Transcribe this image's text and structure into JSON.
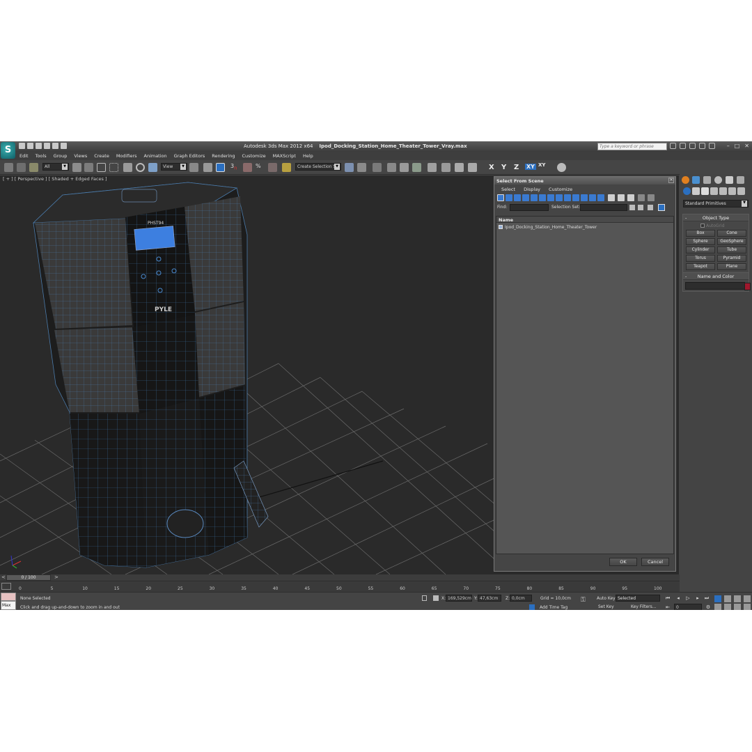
{
  "window": {
    "title_app": "Autodesk 3ds Max  2012 x64",
    "title_file": "Ipod_Docking_Station_Home_Theater_Tower_Vray.max",
    "search_placeholder": "Type a keyword or phrase"
  },
  "menu": [
    "Edit",
    "Tools",
    "Group",
    "Views",
    "Create",
    "Modifiers",
    "Animation",
    "Graph Editors",
    "Rendering",
    "Customize",
    "MAXScript",
    "Help"
  ],
  "toolbar": {
    "filter_value": "All",
    "ref_coord_value": "View",
    "selection_set_placeholder": "Create Selection Se",
    "axes": [
      "X",
      "Y",
      "Z",
      "XY",
      "XY"
    ]
  },
  "viewport": {
    "label": "[ + ] [ Perspective ] [ Shaded + Edged Faces ]",
    "model_logo_text": "PYLE",
    "model_display_text": "PHST94"
  },
  "select_dialog": {
    "title": "Select From Scene",
    "menu": [
      "Select",
      "Display",
      "Customize"
    ],
    "find_label": "Find:",
    "selection_set_label": "Selection Set:",
    "list_header": "Name",
    "items": [
      "Ipod_Docking_Station_Home_Theater_Tower"
    ],
    "ok_label": "OK",
    "cancel_label": "Cancel"
  },
  "command_panel": {
    "category": "Standard Primitives",
    "object_type_title": "Object Type",
    "autogrid_label": "AutoGrid",
    "primitives": [
      "Box",
      "Cone",
      "Sphere",
      "GeoSphere",
      "Cylinder",
      "Tube",
      "Torus",
      "Pyramid",
      "Teapot",
      "Plane"
    ],
    "name_color_title": "Name and Color",
    "object_color": "#a0182d"
  },
  "timeline": {
    "slider_label": "0 / 100",
    "ticks": [
      "0",
      "5",
      "10",
      "15",
      "20",
      "25",
      "30",
      "35",
      "40",
      "45",
      "50",
      "55",
      "60",
      "65",
      "70",
      "75",
      "80",
      "85",
      "90",
      "95",
      "100"
    ]
  },
  "status": {
    "maxscript_label": "Max",
    "selection_text": "None Selected",
    "prompt_text": "Click and drag up-and-down to zoom in and out",
    "x_label": "X:",
    "x_value": "169,529cm",
    "y_label": "Y:",
    "y_value": "47,63cm",
    "z_label": "Z:",
    "z_value": "0,0cm",
    "grid_text": "Grid = 10,0cm",
    "add_time_tag": "Add Time Tag",
    "auto_key_label": "Auto Key",
    "auto_key_value": "Selected",
    "set_key_label": "Set Key",
    "key_filters_label": "Key Filters...",
    "frame_value": "0"
  }
}
